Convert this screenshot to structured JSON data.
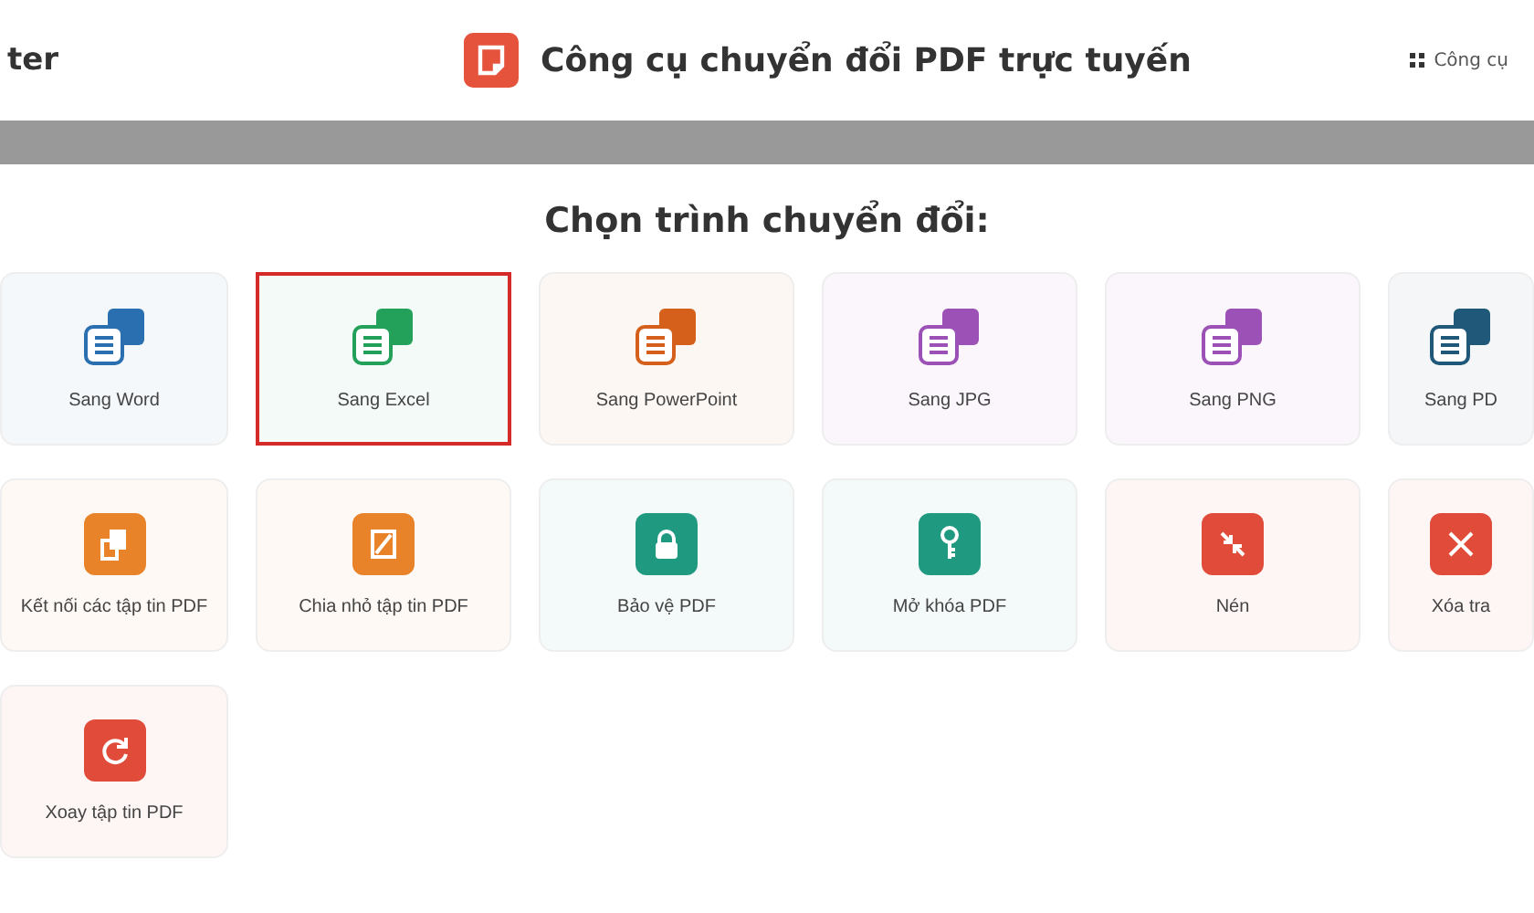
{
  "header": {
    "left_text": "ter",
    "title": "Công cụ chuyển đổi PDF trực tuyến",
    "menu_label": "Công cụ"
  },
  "heading": "Chọn trình chuyển đổi:",
  "tools": [
    {
      "label": "Sang Word",
      "kind": "convert",
      "color": "#2a6fb0",
      "selected": false
    },
    {
      "label": "Sang Excel",
      "kind": "convert",
      "color": "#23a05a",
      "selected": true
    },
    {
      "label": "Sang PowerPoint",
      "kind": "convert",
      "color": "#d4601c",
      "selected": false
    },
    {
      "label": "Sang JPG",
      "kind": "convert",
      "color": "#9b51b5",
      "selected": false
    },
    {
      "label": "Sang PNG",
      "kind": "convert",
      "color": "#9b51b5",
      "selected": false
    },
    {
      "label": "Sang PD",
      "kind": "convert",
      "color": "#1f5878",
      "selected": false
    },
    {
      "label": "Kết nối các tập tin PDF",
      "kind": "tool",
      "color": "#e8832a",
      "selected": false
    },
    {
      "label": "Chia nhỏ tập tin PDF",
      "kind": "tool",
      "color": "#e8832a",
      "selected": false
    },
    {
      "label": "Bảo vệ PDF",
      "kind": "tool",
      "color": "#1f9a80",
      "selected": false
    },
    {
      "label": "Mở khóa PDF",
      "kind": "tool",
      "color": "#1f9a80",
      "selected": false
    },
    {
      "label": "Nén",
      "kind": "tool",
      "color": "#e14c3a",
      "selected": false
    },
    {
      "label": "Xóa tra",
      "kind": "tool",
      "color": "#e14c3a",
      "selected": false
    },
    {
      "label": "Xoay tập tin PDF",
      "kind": "tool",
      "color": "#e14c3a",
      "selected": false
    }
  ]
}
